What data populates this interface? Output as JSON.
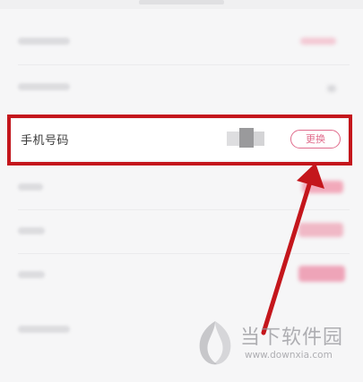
{
  "phone_row": {
    "label": "手机号码",
    "change_button": "更换"
  },
  "watermark": {
    "title": "当下软件园",
    "url": "www.downxia.com"
  },
  "colors": {
    "accent_pink": "#e06c8c",
    "highlight_red": "#c4161c",
    "background": "#f6f6f7"
  }
}
